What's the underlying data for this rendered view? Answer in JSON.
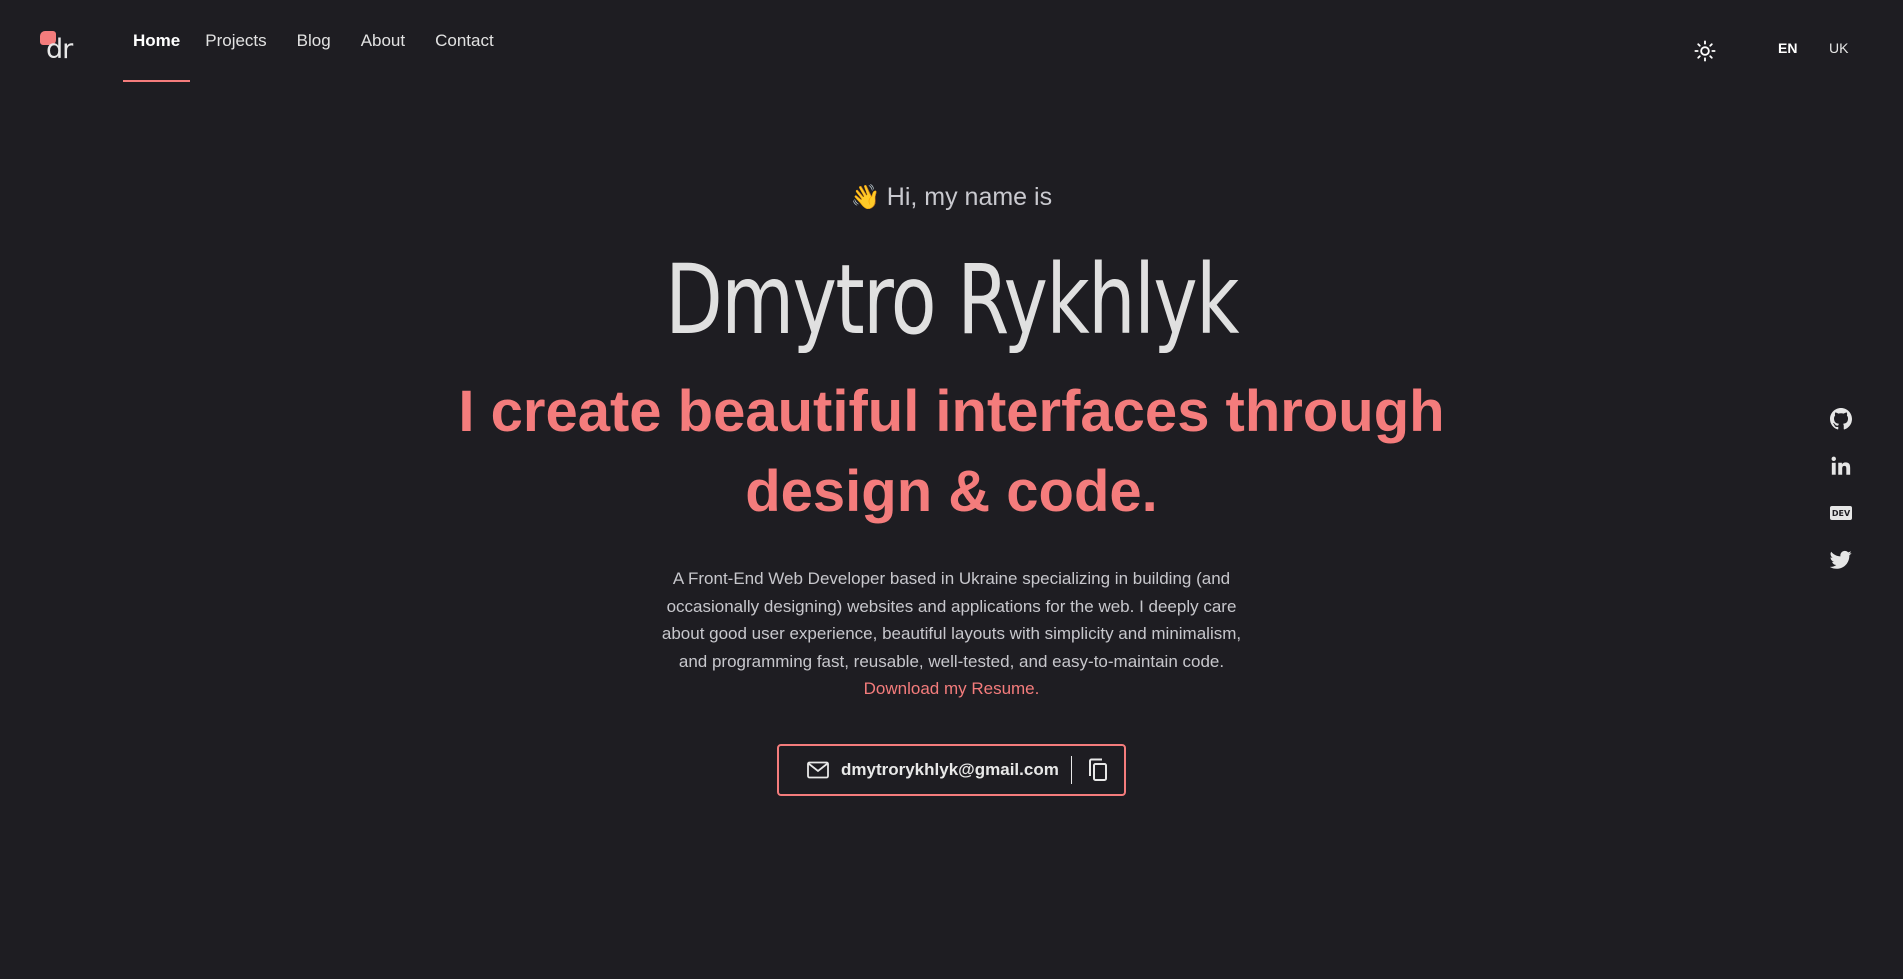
{
  "logo": {
    "text": "dr"
  },
  "nav": {
    "items": [
      {
        "label": "Home",
        "active": true
      },
      {
        "label": "Projects",
        "active": false
      },
      {
        "label": "Blog",
        "active": false
      },
      {
        "label": "About",
        "active": false
      },
      {
        "label": "Contact",
        "active": false
      }
    ]
  },
  "header": {
    "theme_icon": "sun-icon",
    "languages": [
      "EN",
      "UK"
    ],
    "active_language": "EN"
  },
  "hero": {
    "greeting_emoji": "👋",
    "greeting": "Hi, my name is",
    "name": "Dmytro Rykhlyk",
    "tagline": "I create beautiful interfaces through design & code.",
    "intro": "A Front-End Web Developer based in Ukraine specializing in building (and occasionally designing) websites and applications for the web. I deeply care about good user experience, beautiful layouts with simplicity and minimalism, and programming fast, reusable, well-tested, and easy-to-maintain code.",
    "resume_link": "Download my Resume.",
    "email": "dmytrorykhlyk@gmail.com"
  },
  "social": {
    "items": [
      {
        "icon": "github-icon"
      },
      {
        "icon": "linkedin-icon"
      },
      {
        "icon": "dev-icon",
        "label": "DEV"
      },
      {
        "icon": "twitter-icon"
      }
    ]
  },
  "colors": {
    "background": "#1e1d22",
    "accent": "#f47c7c",
    "text": "#e6e6e6"
  }
}
